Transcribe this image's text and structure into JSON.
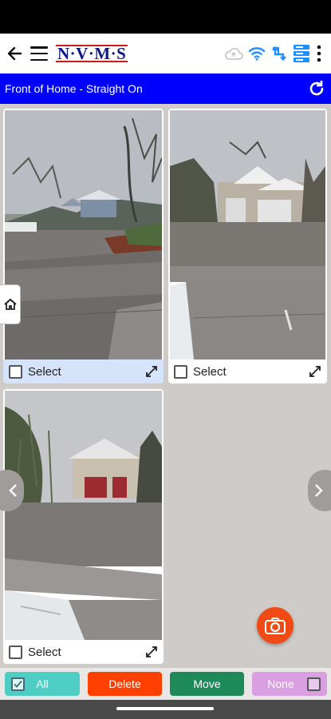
{
  "app": {
    "logo": "N·V·M·S"
  },
  "toolbar": {
    "section_title": "Front of Home - Straight On"
  },
  "photos": [
    {
      "select_label": "Select",
      "selected": true
    },
    {
      "select_label": "Select",
      "selected": false
    },
    {
      "select_label": "Select",
      "selected": false
    }
  ],
  "bottom_actions": {
    "all_label": "All",
    "delete_label": "Delete",
    "move_label": "Move",
    "none_label": "None"
  },
  "colors": {
    "title_bar": "#0000ff",
    "all": "#4ecdc4",
    "delete": "#ff4000",
    "move": "#1e8a5a",
    "none": "#d99fe0",
    "camera": "#f04b14"
  },
  "icons": [
    "back-arrow-icon",
    "hamburger-menu-icon",
    "cloud-upload-icon",
    "wifi-icon",
    "sync-arrows-icon",
    "server-stack-icon",
    "more-vert-icon",
    "refresh-icon",
    "house-icon",
    "expand-icon",
    "chevron-left-icon",
    "chevron-right-icon",
    "camera-icon"
  ]
}
